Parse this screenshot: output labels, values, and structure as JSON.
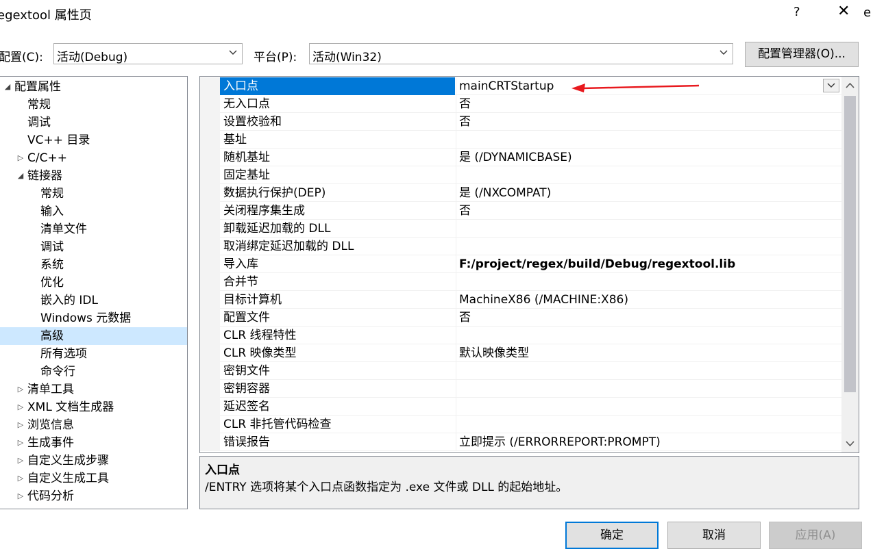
{
  "window": {
    "title": "egextool 属性页",
    "help": "?",
    "close": "✕",
    "edge_char": "e"
  },
  "toolbar": {
    "config_label": "配置(C):",
    "config_value": "活动(Debug)",
    "platform_label": "平台(P):",
    "platform_value": "活动(Win32)",
    "manager_button": "配置管理器(O)..."
  },
  "tree": {
    "items": [
      {
        "label": "配置属性",
        "expander": "◢",
        "level": 0
      },
      {
        "label": "常规",
        "expander": "",
        "level": 1
      },
      {
        "label": "调试",
        "expander": "",
        "level": 1
      },
      {
        "label": "VC++ 目录",
        "expander": "",
        "level": 1
      },
      {
        "label": "C/C++",
        "expander": "▷",
        "level": 1
      },
      {
        "label": "链接器",
        "expander": "◢",
        "level": 1
      },
      {
        "label": "常规",
        "expander": "",
        "level": 2
      },
      {
        "label": "输入",
        "expander": "",
        "level": 2
      },
      {
        "label": "清单文件",
        "expander": "",
        "level": 2
      },
      {
        "label": "调试",
        "expander": "",
        "level": 2
      },
      {
        "label": "系统",
        "expander": "",
        "level": 2
      },
      {
        "label": "优化",
        "expander": "",
        "level": 2
      },
      {
        "label": "嵌入的 IDL",
        "expander": "",
        "level": 2
      },
      {
        "label": "Windows 元数据",
        "expander": "",
        "level": 2
      },
      {
        "label": "高级",
        "expander": "",
        "level": 2,
        "selected": true
      },
      {
        "label": "所有选项",
        "expander": "",
        "level": 2
      },
      {
        "label": "命令行",
        "expander": "",
        "level": 2
      },
      {
        "label": "清单工具",
        "expander": "▷",
        "level": 1
      },
      {
        "label": "XML 文档生成器",
        "expander": "▷",
        "level": 1
      },
      {
        "label": "浏览信息",
        "expander": "▷",
        "level": 1
      },
      {
        "label": "生成事件",
        "expander": "▷",
        "level": 1
      },
      {
        "label": "自定义生成步骤",
        "expander": "▷",
        "level": 1
      },
      {
        "label": "自定义生成工具",
        "expander": "▷",
        "level": 1
      },
      {
        "label": "代码分析",
        "expander": "▷",
        "level": 1
      }
    ]
  },
  "grid": {
    "rows": [
      {
        "name": "入口点",
        "value": "mainCRTStartup",
        "selected": true,
        "dropdown": true
      },
      {
        "name": "无入口点",
        "value": "否"
      },
      {
        "name": "设置校验和",
        "value": "否"
      },
      {
        "name": "基址",
        "value": ""
      },
      {
        "name": "随机基址",
        "value": "是 (/DYNAMICBASE)"
      },
      {
        "name": "固定基址",
        "value": ""
      },
      {
        "name": "数据执行保护(DEP)",
        "value": "是 (/NXCOMPAT)"
      },
      {
        "name": "关闭程序集生成",
        "value": "否"
      },
      {
        "name": "卸载延迟加载的 DLL",
        "value": ""
      },
      {
        "name": "取消绑定延迟加载的 DLL",
        "value": ""
      },
      {
        "name": "导入库",
        "value": "F:/project/regex/build/Debug/regextool.lib",
        "bold": true
      },
      {
        "name": "合并节",
        "value": ""
      },
      {
        "name": "目标计算机",
        "value": "MachineX86 (/MACHINE:X86)"
      },
      {
        "name": "配置文件",
        "value": "否"
      },
      {
        "name": "CLR 线程特性",
        "value": ""
      },
      {
        "name": "CLR 映像类型",
        "value": "默认映像类型"
      },
      {
        "name": "密钥文件",
        "value": ""
      },
      {
        "name": "密钥容器",
        "value": ""
      },
      {
        "name": "延迟签名",
        "value": ""
      },
      {
        "name": "CLR 非托管代码检查",
        "value": ""
      },
      {
        "name": "错误报告",
        "value": "立即提示 (/ERRORREPORT:PROMPT)"
      }
    ]
  },
  "description": {
    "title": "入口点",
    "text": "/ENTRY 选项将某个入口点函数指定为 .exe 文件或 DLL 的起始地址。"
  },
  "buttons": {
    "ok": "确定",
    "cancel": "取消",
    "apply": "应用(A)"
  },
  "colors": {
    "selection": "#0078d7",
    "tree_selection": "#cde8ff",
    "annotation_arrow": "#e8191e"
  },
  "icons": {
    "combo_arrow": "chevron-down-icon",
    "scroll_up": "chevron-up-icon",
    "scroll_down": "chevron-down-icon",
    "annotation": "red-arrow-icon"
  }
}
